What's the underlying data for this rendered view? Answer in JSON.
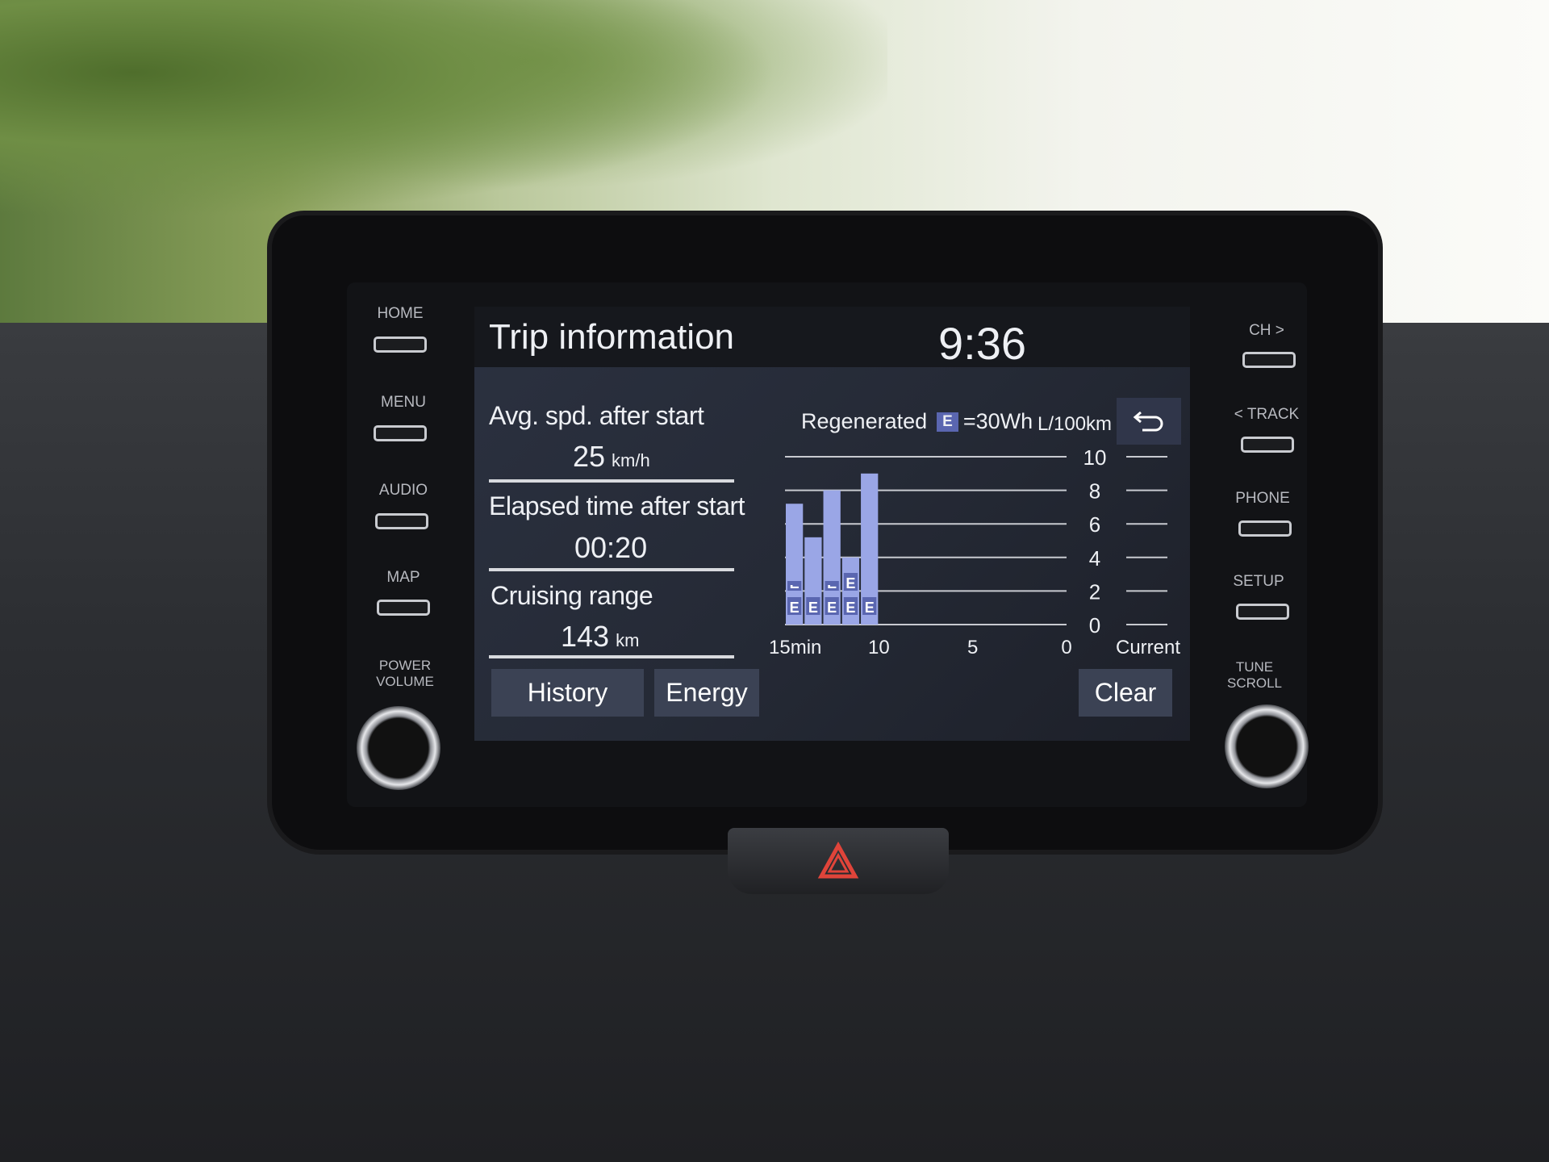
{
  "header": {
    "title": "Trip information",
    "clock": "9:36"
  },
  "left_buttons": [
    {
      "label": "HOME"
    },
    {
      "label": "MENU"
    },
    {
      "label": "AUDIO"
    },
    {
      "label": "MAP"
    }
  ],
  "left_knob_label": [
    "POWER",
    "VOLUME"
  ],
  "right_buttons": [
    {
      "label": "CH >"
    },
    {
      "label": "< TRACK"
    },
    {
      "label": "PHONE"
    },
    {
      "label": "SETUP"
    }
  ],
  "right_knob_label": [
    "TUNE",
    "SCROLL"
  ],
  "stats": [
    {
      "label": "Avg. spd. after start",
      "value": "25",
      "unit": "km/h"
    },
    {
      "label": "Elapsed time after start",
      "value": "00:20",
      "unit": ""
    },
    {
      "label": "Cruising range",
      "value": "143",
      "unit": "km"
    }
  ],
  "buttons": {
    "history": "History",
    "energy": "Energy",
    "clear": "Clear"
  },
  "legend": {
    "prefix": "Regenerated",
    "badge": "E",
    "suffix": "=30Wh"
  },
  "colors": {
    "bar": "#9aa6e6",
    "badge": "#5a66b0",
    "button": "#3b4254",
    "screen_bg": "#252a36"
  },
  "chart_data": {
    "type": "bar",
    "ylabel": "L/100km",
    "ylim": [
      0,
      10
    ],
    "yticks": [
      "10",
      "8",
      "6",
      "4",
      "2",
      "0"
    ],
    "xticks": [
      "15min",
      "10",
      "5",
      "0"
    ],
    "current_label": "Current",
    "grid": true,
    "x": [
      15,
      14,
      13,
      12,
      11
    ],
    "values": [
      7.2,
      5.2,
      8.0,
      4.0,
      9.0
    ],
    "regenerated_E_blocks": [
      1.5,
      1,
      1.5,
      2,
      1
    ]
  }
}
